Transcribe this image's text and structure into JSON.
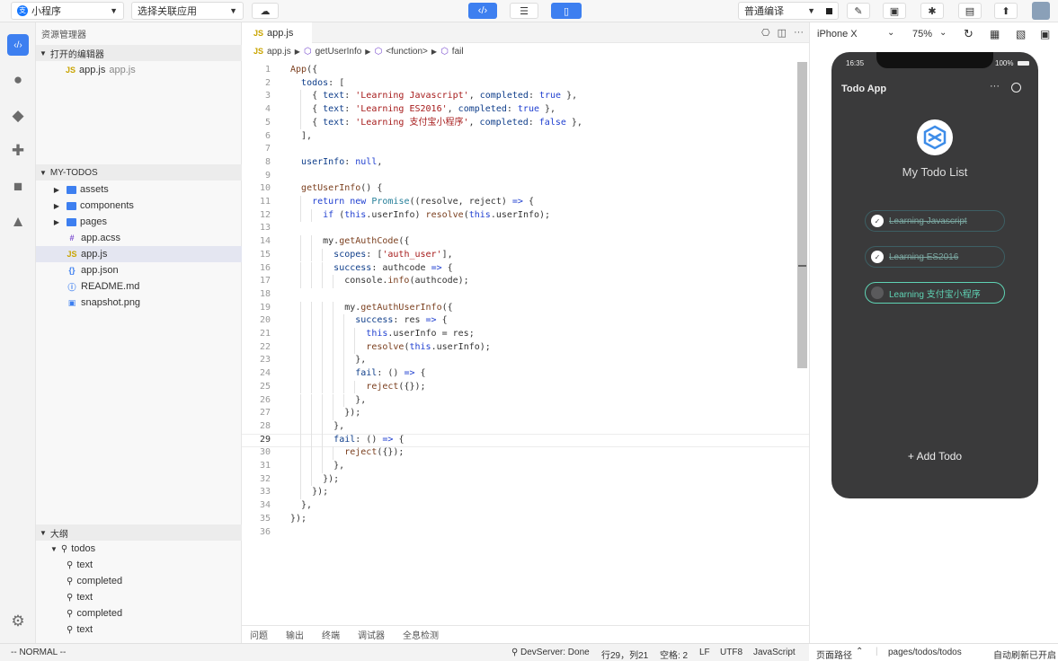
{
  "topbar": {
    "app_type": "小程序",
    "linked_app": "选择关联应用",
    "compile_mode": "普通编译"
  },
  "activity": {
    "items": [
      "files",
      "search",
      "git",
      "extensions",
      "device",
      "lab",
      "settings"
    ]
  },
  "explorer": {
    "title": "资源管理器",
    "open_editors_label": "打开的编辑器",
    "open_editor_item": {
      "badge": "JS",
      "name": "app.js",
      "desc": "app.js"
    },
    "project_label": "MY-TODOS",
    "tree": [
      {
        "name": "assets",
        "kind": "folder",
        "badge": "▶"
      },
      {
        "name": "components",
        "kind": "folder",
        "badge": "▶"
      },
      {
        "name": "pages",
        "kind": "folder",
        "badge": "▶"
      },
      {
        "name": "app.acss",
        "kind": "file",
        "badge": "#"
      },
      {
        "name": "app.js",
        "kind": "file",
        "badge": "JS"
      },
      {
        "name": "app.json",
        "kind": "file",
        "badge": "{}"
      },
      {
        "name": "README.md",
        "kind": "file",
        "badge": "ⓘ"
      },
      {
        "name": "snapshot.png",
        "kind": "file",
        "badge": "▣"
      }
    ],
    "outline_label": "大纲",
    "outline": [
      {
        "name": "todos",
        "level": 0
      },
      {
        "name": "text",
        "level": 1
      },
      {
        "name": "completed",
        "level": 1
      },
      {
        "name": "text",
        "level": 1
      },
      {
        "name": "completed",
        "level": 1
      },
      {
        "name": "text",
        "level": 1
      }
    ]
  },
  "editor": {
    "tab": {
      "badge": "JS",
      "name": "app.js"
    },
    "breadcrumb": {
      "file_badge": "JS",
      "file": "app.js",
      "items": [
        "getUserInfo",
        "<function>",
        "fail"
      ]
    },
    "current_line": 29,
    "code_lines": [
      "App({",
      "  todos: [",
      "    { text: 'Learning Javascript', completed: true },",
      "    { text: 'Learning ES2016', completed: true },",
      "    { text: 'Learning 支付宝小程序', completed: false },",
      "  ],",
      "",
      "  userInfo: null,",
      "",
      "  getUserInfo() {",
      "    return new Promise((resolve, reject) => {",
      "      if (this.userInfo) resolve(this.userInfo);",
      "",
      "      my.getAuthCode({",
      "        scopes: ['auth_user'],",
      "        success: authcode => {",
      "          console.info(authcode);",
      "",
      "          my.getAuthUserInfo({",
      "            success: res => {",
      "              this.userInfo = res;",
      "              resolve(this.userInfo);",
      "            },",
      "            fail: () => {",
      "              reject({});",
      "            },",
      "          });",
      "        },",
      "        fail: () => {",
      "          reject({});",
      "        },",
      "      });",
      "    });",
      "  },",
      "});",
      ""
    ],
    "panel_tabs": [
      "问题",
      "输出",
      "终端",
      "调试器",
      "全息检测"
    ]
  },
  "status": {
    "mode": "-- NORMAL --",
    "devserver": "DevServer: Done",
    "position": "行29，列21",
    "spaces": "空格: 2",
    "eol": "LF",
    "encoding": "UTF8",
    "language": "JavaScript"
  },
  "simulator": {
    "device": "iPhone X",
    "zoom": "75%",
    "time": "16:35",
    "battery": "100%",
    "nav_title": "Todo App",
    "heading": "My Todo List",
    "todos": [
      {
        "text": "Learning Javascript",
        "completed": true
      },
      {
        "text": "Learning ES2016",
        "completed": true
      },
      {
        "text": "Learning 支付宝小程序",
        "completed": false
      }
    ],
    "add_label": "Add Todo",
    "page_path_label": "页面路径",
    "page_path": "pages/todos/todos",
    "auto_refresh": "自动刷新已开启",
    "accent": "#5fd3b4"
  }
}
